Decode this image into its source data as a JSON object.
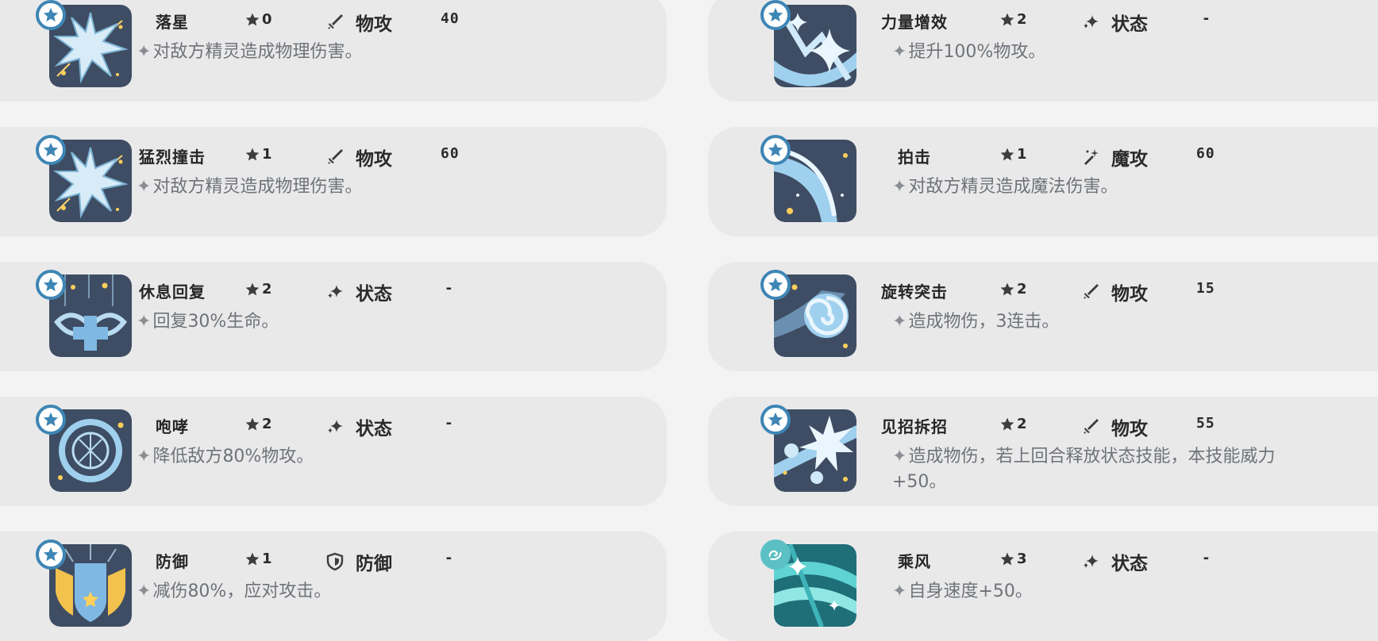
{
  "colors": {
    "card_bg": "#e9e9ea",
    "badge_ring": "#3e86b5",
    "badge_wind": "#5bc0c4",
    "text_dark": "#262626",
    "text_desc": "#6f7378"
  },
  "skills": [
    {
      "name": "落星",
      "cost": "0",
      "type": "物攻",
      "type_icon": "sword-icon",
      "power": "40",
      "desc": "对敌方精灵造成物理伤害。",
      "icon": "shatter-icon"
    },
    {
      "name": "力量增效",
      "cost": "2",
      "type": "状态",
      "type_icon": "sparkle-icon",
      "power": "-",
      "desc": "提升100%物攻。",
      "icon": "power-boost-icon"
    },
    {
      "name": "猛烈撞击",
      "cost": "1",
      "type": "物攻",
      "type_icon": "sword-icon",
      "power": "60",
      "desc": "对敌方精灵造成物理伤害。",
      "icon": "shatter-icon"
    },
    {
      "name": "拍击",
      "cost": "1",
      "type": "魔攻",
      "type_icon": "wand-icon",
      "power": "60",
      "desc": "对敌方精灵造成魔法伤害。",
      "icon": "slash-icon"
    },
    {
      "name": "休息回复",
      "cost": "2",
      "type": "状态",
      "type_icon": "sparkle-icon",
      "power": "-",
      "desc": "回复30%生命。",
      "icon": "heal-cross-icon"
    },
    {
      "name": "旋转突击",
      "cost": "2",
      "type": "物攻",
      "type_icon": "sword-icon",
      "power": "15",
      "desc": "造成物伤，3连击。",
      "icon": "spiral-icon"
    },
    {
      "name": "咆哮",
      "cost": "2",
      "type": "状态",
      "type_icon": "sparkle-icon",
      "power": "-",
      "desc": "降低敌方80%物攻。",
      "icon": "roar-ring-icon"
    },
    {
      "name": "见招拆招",
      "cost": "2",
      "type": "物攻",
      "type_icon": "sword-icon",
      "power": "55",
      "desc": "造成物伤，若上回合释放状态技能，本技能威力",
      "desc2": "+50。",
      "icon": "burst-icon"
    },
    {
      "name": "防御",
      "cost": "1",
      "type": "防御",
      "type_icon": "shield-icon",
      "power": "-",
      "desc": "减伤80%，应对攻击。",
      "icon": "defense-icon"
    },
    {
      "name": "乘风",
      "cost": "3",
      "type": "状态",
      "type_icon": "sparkle-icon",
      "power": "-",
      "desc": "自身速度+50。",
      "icon": "wind-icon"
    }
  ]
}
